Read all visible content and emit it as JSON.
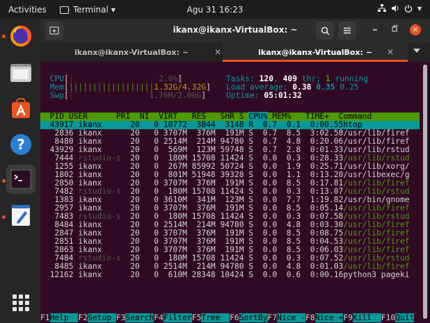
{
  "topbar": {
    "activities": "Activities",
    "app_name": "Terminal",
    "clock": "Agu 31  16:23"
  },
  "window": {
    "title": "ikanx@ikanx-VirtualBox: ~",
    "tabs": [
      {
        "label": "ikanx@ikanx-VirtualBox: ~"
      },
      {
        "label": "ikanx@ikanx-VirtualBox: ~"
      }
    ]
  },
  "htop": {
    "meters": {
      "cpu_label": "CPU",
      "cpu_bar": "|",
      "cpu_value": "2.0%",
      "mem_label": "Mem",
      "mem_bar": "||||||||||||||||||",
      "mem_value": "1.32G/4.32G",
      "swp_label": "Swp",
      "swp_value": "1.76M/2.00G"
    },
    "info": {
      "tasks_label": "Tasks: ",
      "tasks_count": "120",
      "tasks_thr_sep": ", ",
      "tasks_thr": "409",
      "tasks_thr_label": " thr; ",
      "tasks_running": "1",
      "tasks_running_label": " running",
      "load_label": "Load average: ",
      "load_1": "0.38",
      "load_5": "0.35",
      "load_15": "0.25",
      "uptime_label": "Uptime: ",
      "uptime_value": "05:01:32"
    },
    "columns": {
      "pid": "PID",
      "user": "USER",
      "pri": "PRI",
      "ni": "NI",
      "virt": "VIRT",
      "res": "RES",
      "shr": "SHR",
      "s": "S",
      "cpu": "CPU%",
      "mem": "MEM%",
      "time": "TIME+",
      "command": "Command"
    },
    "processes": [
      {
        "pid": "43917",
        "user": "ikanx",
        "pri": "20",
        "ni": "0",
        "virt": "10772",
        "res": "3844",
        "shr": "3148",
        "s": "R",
        "cpu": "0.7",
        "mem": "0.1",
        "time": "0:00.55",
        "command": "htop"
      },
      {
        "pid": "2836",
        "user": "ikanx",
        "pri": "20",
        "ni": "0",
        "virt": "3707M",
        "res": "376M",
        "shr": "191M",
        "s": "S",
        "cpu": "0.7",
        "mem": "8.5",
        "time": "3:02.58",
        "command": "/usr/lib/firef"
      },
      {
        "pid": "8480",
        "user": "ikanx",
        "pri": "20",
        "ni": "0",
        "virt": "2514M",
        "res": "214M",
        "shr": "94780",
        "s": "S",
        "cpu": "0.7",
        "mem": "4.8",
        "time": "0:20.06",
        "command": "/usr/lib/firef"
      },
      {
        "pid": "43929",
        "user": "ikanx",
        "pri": "20",
        "ni": "0",
        "virt": "569M",
        "res": "123M",
        "shr": "59748",
        "s": "S",
        "cpu": "0.7",
        "mem": "2.8",
        "time": "0:01.33",
        "command": "/usr/lib/rstud"
      },
      {
        "pid": "7444",
        "user": "rstudio-s",
        "pri": "20",
        "ni": "0",
        "virt": "180M",
        "res": "15708",
        "shr": "11424",
        "s": "S",
        "cpu": "0.0",
        "mem": "0.3",
        "time": "0:28.33",
        "command": "/usr/lib/rstud"
      },
      {
        "pid": "1255",
        "user": "ikanx",
        "pri": "20",
        "ni": "0",
        "virt": "267M",
        "res": "85992",
        "shr": "50724",
        "s": "S",
        "cpu": "0.0",
        "mem": "1.9",
        "time": "0:25.71",
        "command": "/usr/lib/xorg/"
      },
      {
        "pid": "1802",
        "user": "ikanx",
        "pri": "20",
        "ni": "0",
        "virt": "801M",
        "res": "51948",
        "shr": "39328",
        "s": "S",
        "cpu": "0.0",
        "mem": "1.1",
        "time": "0:13.20",
        "command": "/usr/libexec/g"
      },
      {
        "pid": "2850",
        "user": "ikanx",
        "pri": "20",
        "ni": "0",
        "virt": "3707M",
        "res": "376M",
        "shr": "191M",
        "s": "S",
        "cpu": "0.0",
        "mem": "8.5",
        "time": "0:17.81",
        "command": "/usr/lib/firef"
      },
      {
        "pid": "7482",
        "user": "rstudio-s",
        "pri": "20",
        "ni": "0",
        "virt": "180M",
        "res": "15708",
        "shr": "11424",
        "s": "S",
        "cpu": "0.0",
        "mem": "0.3",
        "time": "0:13.07",
        "command": "/usr/lib/rstud"
      },
      {
        "pid": "1383",
        "user": "ikanx",
        "pri": "20",
        "ni": "0",
        "virt": "3610M",
        "res": "341M",
        "shr": "123M",
        "s": "S",
        "cpu": "0.0",
        "mem": "7.7",
        "time": "1:19.82",
        "command": "/usr/bin/gnome"
      },
      {
        "pid": "2957",
        "user": "ikanx",
        "pri": "20",
        "ni": "0",
        "virt": "3707M",
        "res": "376M",
        "shr": "191M",
        "s": "S",
        "cpu": "0.0",
        "mem": "8.5",
        "time": "0:05.14",
        "command": "/usr/lib/firef"
      },
      {
        "pid": "7483",
        "user": "rstudio-s",
        "pri": "20",
        "ni": "0",
        "virt": "180M",
        "res": "15708",
        "shr": "11424",
        "s": "S",
        "cpu": "0.0",
        "mem": "0.3",
        "time": "0:07.58",
        "command": "/usr/lib/rstud"
      },
      {
        "pid": "8484",
        "user": "ikanx",
        "pri": "20",
        "ni": "0",
        "virt": "2514M",
        "res": "214M",
        "shr": "94780",
        "s": "S",
        "cpu": "0.0",
        "mem": "4.8",
        "time": "0:03.30",
        "command": "/usr/lib/firef"
      },
      {
        "pid": "2847",
        "user": "ikanx",
        "pri": "20",
        "ni": "0",
        "virt": "3707M",
        "res": "376M",
        "shr": "191M",
        "s": "S",
        "cpu": "0.0",
        "mem": "8.5",
        "time": "0:08.75",
        "command": "/usr/lib/firef"
      },
      {
        "pid": "2851",
        "user": "ikanx",
        "pri": "20",
        "ni": "0",
        "virt": "3707M",
        "res": "376M",
        "shr": "191M",
        "s": "S",
        "cpu": "0.0",
        "mem": "8.5",
        "time": "0:04.53",
        "command": "/usr/lib/firef"
      },
      {
        "pid": "2863",
        "user": "ikanx",
        "pri": "20",
        "ni": "0",
        "virt": "3707M",
        "res": "376M",
        "shr": "191M",
        "s": "S",
        "cpu": "0.0",
        "mem": "8.5",
        "time": "0:06.03",
        "command": "/usr/lib/firef"
      },
      {
        "pid": "7484",
        "user": "rstudio-s",
        "pri": "20",
        "ni": "0",
        "virt": "180M",
        "res": "15708",
        "shr": "11424",
        "s": "S",
        "cpu": "0.0",
        "mem": "0.3",
        "time": "0:07.52",
        "command": "/usr/lib/rstud"
      },
      {
        "pid": "8485",
        "user": "ikanx",
        "pri": "20",
        "ni": "0",
        "virt": "2514M",
        "res": "214M",
        "shr": "94780",
        "s": "S",
        "cpu": "0.0",
        "mem": "4.8",
        "time": "0:01.03",
        "command": "/usr/lib/firef"
      },
      {
        "pid": "12162",
        "user": "ikanx",
        "pri": "20",
        "ni": "0",
        "virt": "610M",
        "res": "28348",
        "shr": "10424",
        "s": "S",
        "cpu": "0.0",
        "mem": "0.6",
        "time": "0:00.16",
        "command": "python3 pageki"
      }
    ],
    "function_keys": [
      {
        "key": "F1",
        "label": "Help  "
      },
      {
        "key": "F2",
        "label": "Setup "
      },
      {
        "key": "F3",
        "label": "Search"
      },
      {
        "key": "F4",
        "label": "Filter"
      },
      {
        "key": "F5",
        "label": "Tree  "
      },
      {
        "key": "F6",
        "label": "SortBy"
      },
      {
        "key": "F7",
        "label": "Nice -"
      },
      {
        "key": "F8",
        "label": "Nice +"
      },
      {
        "key": "F9",
        "label": "Kill  "
      },
      {
        "key": "F10",
        "label": "Quit"
      }
    ]
  },
  "colors": {
    "accent": "#e95420",
    "terminal_bg": "#300a24",
    "header_green": "#4e9a06",
    "cyan": "#06989a"
  }
}
